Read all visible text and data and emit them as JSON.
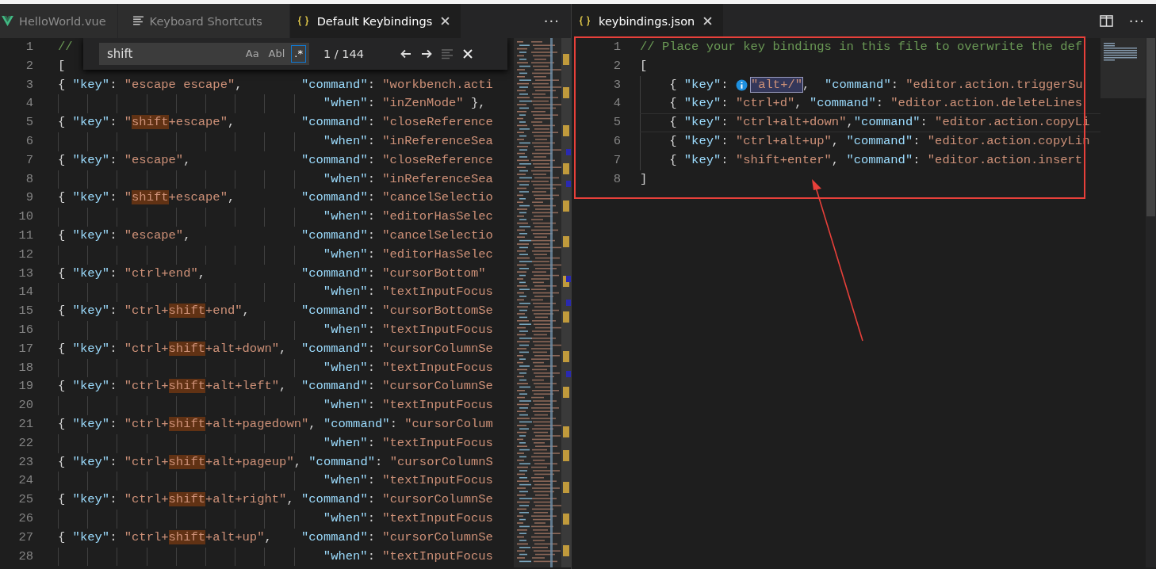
{
  "left_group": {
    "tabs": [
      {
        "label": "HelloWorld.vue",
        "kind": "vue",
        "selected": false
      },
      {
        "label": "Keyboard Shortcuts",
        "kind": "preview",
        "selected": false
      },
      {
        "label": "Default Keybindings",
        "kind": "json",
        "selected": true
      }
    ],
    "more": "···",
    "find": {
      "query": "shift",
      "toggles": [
        {
          "label": "Aa",
          "on": false
        },
        {
          "label": "Abl",
          "on": false
        },
        {
          "label": ".*",
          "on": true
        }
      ],
      "count": "1 / 144"
    },
    "lines": [
      {
        "n": "1",
        "tokens": [
          {
            "kind": "comment",
            "text": "//"
          }
        ]
      },
      {
        "n": "2",
        "tokens": [
          {
            "kind": "punct",
            "text": "["
          }
        ]
      },
      {
        "n": "3",
        "tokens": [
          {
            "kind": "punct",
            "text": "{ "
          },
          {
            "kind": "key",
            "text": "\"key\""
          },
          {
            "kind": "punct",
            "text": ": "
          },
          {
            "kind": "string",
            "text": "\"escape escape\""
          },
          {
            "kind": "punct",
            "text": ",        "
          },
          {
            "kind": "key",
            "text": "\"command\""
          },
          {
            "kind": "punct",
            "text": ": "
          },
          {
            "kind": "string",
            "text": "\"workbench.acti"
          }
        ]
      },
      {
        "n": "4",
        "kind": "continuation",
        "tokens": [
          {
            "kind": "key",
            "text": "\"when\""
          },
          {
            "kind": "punct",
            "text": ": "
          },
          {
            "kind": "string",
            "text": "\"inZenMode\""
          },
          {
            "kind": "punct",
            "text": " },"
          }
        ]
      },
      {
        "n": "5",
        "tokens": [
          {
            "kind": "punct",
            "text": "{ "
          },
          {
            "kind": "key",
            "text": "\"key\""
          },
          {
            "kind": "punct",
            "text": ": "
          },
          {
            "kind": "string",
            "text": "\""
          },
          {
            "kind": "match",
            "text": "shift"
          },
          {
            "kind": "string",
            "text": "+escape\""
          },
          {
            "kind": "punct",
            "text": ",         "
          },
          {
            "kind": "key",
            "text": "\"command\""
          },
          {
            "kind": "punct",
            "text": ": "
          },
          {
            "kind": "string",
            "text": "\"closeReference"
          }
        ]
      },
      {
        "n": "6",
        "kind": "continuation",
        "tokens": [
          {
            "kind": "key",
            "text": "\"when\""
          },
          {
            "kind": "punct",
            "text": ": "
          },
          {
            "kind": "string",
            "text": "\"inReferenceSea"
          }
        ]
      },
      {
        "n": "7",
        "tokens": [
          {
            "kind": "punct",
            "text": "{ "
          },
          {
            "kind": "key",
            "text": "\"key\""
          },
          {
            "kind": "punct",
            "text": ": "
          },
          {
            "kind": "string",
            "text": "\"escape\""
          },
          {
            "kind": "punct",
            "text": ",               "
          },
          {
            "kind": "key",
            "text": "\"command\""
          },
          {
            "kind": "punct",
            "text": ": "
          },
          {
            "kind": "string",
            "text": "\"closeReference"
          }
        ]
      },
      {
        "n": "8",
        "kind": "continuation",
        "tokens": [
          {
            "kind": "key",
            "text": "\"when\""
          },
          {
            "kind": "punct",
            "text": ": "
          },
          {
            "kind": "string",
            "text": "\"inReferenceSea"
          }
        ]
      },
      {
        "n": "9",
        "tokens": [
          {
            "kind": "punct",
            "text": "{ "
          },
          {
            "kind": "key",
            "text": "\"key\""
          },
          {
            "kind": "punct",
            "text": ": "
          },
          {
            "kind": "string",
            "text": "\""
          },
          {
            "kind": "match",
            "text": "shift"
          },
          {
            "kind": "string",
            "text": "+escape\""
          },
          {
            "kind": "punct",
            "text": ",         "
          },
          {
            "kind": "key",
            "text": "\"command\""
          },
          {
            "kind": "punct",
            "text": ": "
          },
          {
            "kind": "string",
            "text": "\"cancelSelectio"
          }
        ]
      },
      {
        "n": "10",
        "kind": "continuation",
        "tokens": [
          {
            "kind": "key",
            "text": "\"when\""
          },
          {
            "kind": "punct",
            "text": ": "
          },
          {
            "kind": "string",
            "text": "\"editorHasSelec"
          }
        ]
      },
      {
        "n": "11",
        "tokens": [
          {
            "kind": "punct",
            "text": "{ "
          },
          {
            "kind": "key",
            "text": "\"key\""
          },
          {
            "kind": "punct",
            "text": ": "
          },
          {
            "kind": "string",
            "text": "\"escape\""
          },
          {
            "kind": "punct",
            "text": ",               "
          },
          {
            "kind": "key",
            "text": "\"command\""
          },
          {
            "kind": "punct",
            "text": ": "
          },
          {
            "kind": "string",
            "text": "\"cancelSelectio"
          }
        ]
      },
      {
        "n": "12",
        "kind": "continuation",
        "tokens": [
          {
            "kind": "key",
            "text": "\"when\""
          },
          {
            "kind": "punct",
            "text": ": "
          },
          {
            "kind": "string",
            "text": "\"editorHasSelec"
          }
        ]
      },
      {
        "n": "13",
        "tokens": [
          {
            "kind": "punct",
            "text": "{ "
          },
          {
            "kind": "key",
            "text": "\"key\""
          },
          {
            "kind": "punct",
            "text": ": "
          },
          {
            "kind": "string",
            "text": "\"ctrl+end\""
          },
          {
            "kind": "punct",
            "text": ",             "
          },
          {
            "kind": "key",
            "text": "\"command\""
          },
          {
            "kind": "punct",
            "text": ": "
          },
          {
            "kind": "string",
            "text": "\"cursorBottom\""
          }
        ]
      },
      {
        "n": "14",
        "kind": "continuation",
        "tokens": [
          {
            "kind": "key",
            "text": "\"when\""
          },
          {
            "kind": "punct",
            "text": ": "
          },
          {
            "kind": "string",
            "text": "\"textInputFocus"
          }
        ]
      },
      {
        "n": "15",
        "tokens": [
          {
            "kind": "punct",
            "text": "{ "
          },
          {
            "kind": "key",
            "text": "\"key\""
          },
          {
            "kind": "punct",
            "text": ": "
          },
          {
            "kind": "string",
            "text": "\"ctrl+"
          },
          {
            "kind": "match",
            "text": "shift"
          },
          {
            "kind": "string",
            "text": "+end\""
          },
          {
            "kind": "punct",
            "text": ",       "
          },
          {
            "kind": "key",
            "text": "\"command\""
          },
          {
            "kind": "punct",
            "text": ": "
          },
          {
            "kind": "string",
            "text": "\"cursorBottomSe"
          }
        ]
      },
      {
        "n": "16",
        "kind": "continuation",
        "tokens": [
          {
            "kind": "key",
            "text": "\"when\""
          },
          {
            "kind": "punct",
            "text": ": "
          },
          {
            "kind": "string",
            "text": "\"textInputFocus"
          }
        ]
      },
      {
        "n": "17",
        "tokens": [
          {
            "kind": "punct",
            "text": "{ "
          },
          {
            "kind": "key",
            "text": "\"key\""
          },
          {
            "kind": "punct",
            "text": ": "
          },
          {
            "kind": "string",
            "text": "\"ctrl+"
          },
          {
            "kind": "match",
            "text": "shift"
          },
          {
            "kind": "string",
            "text": "+alt+down\""
          },
          {
            "kind": "punct",
            "text": ",  "
          },
          {
            "kind": "key",
            "text": "\"command\""
          },
          {
            "kind": "punct",
            "text": ": "
          },
          {
            "kind": "string",
            "text": "\"cursorColumnSe"
          }
        ]
      },
      {
        "n": "18",
        "kind": "continuation",
        "tokens": [
          {
            "kind": "key",
            "text": "\"when\""
          },
          {
            "kind": "punct",
            "text": ": "
          },
          {
            "kind": "string",
            "text": "\"textInputFocus"
          }
        ]
      },
      {
        "n": "19",
        "tokens": [
          {
            "kind": "punct",
            "text": "{ "
          },
          {
            "kind": "key",
            "text": "\"key\""
          },
          {
            "kind": "punct",
            "text": ": "
          },
          {
            "kind": "string",
            "text": "\"ctrl+"
          },
          {
            "kind": "match",
            "text": "shift"
          },
          {
            "kind": "string",
            "text": "+alt+left\""
          },
          {
            "kind": "punct",
            "text": ",  "
          },
          {
            "kind": "key",
            "text": "\"command\""
          },
          {
            "kind": "punct",
            "text": ": "
          },
          {
            "kind": "string",
            "text": "\"cursorColumnSe"
          }
        ]
      },
      {
        "n": "20",
        "kind": "continuation",
        "tokens": [
          {
            "kind": "key",
            "text": "\"when\""
          },
          {
            "kind": "punct",
            "text": ": "
          },
          {
            "kind": "string",
            "text": "\"textInputFocus"
          }
        ]
      },
      {
        "n": "21",
        "tokens": [
          {
            "kind": "punct",
            "text": "{ "
          },
          {
            "kind": "key",
            "text": "\"key\""
          },
          {
            "kind": "punct",
            "text": ": "
          },
          {
            "kind": "string",
            "text": "\"ctrl+"
          },
          {
            "kind": "match",
            "text": "shift"
          },
          {
            "kind": "string",
            "text": "+alt+pagedown\""
          },
          {
            "kind": "punct",
            "text": ", "
          },
          {
            "kind": "key",
            "text": "\"command\""
          },
          {
            "kind": "punct",
            "text": ": "
          },
          {
            "kind": "string",
            "text": "\"cursorColum"
          }
        ]
      },
      {
        "n": "22",
        "kind": "continuation",
        "tokens": [
          {
            "kind": "key",
            "text": "\"when\""
          },
          {
            "kind": "punct",
            "text": ": "
          },
          {
            "kind": "string",
            "text": "\"textInputFocus"
          }
        ]
      },
      {
        "n": "23",
        "tokens": [
          {
            "kind": "punct",
            "text": "{ "
          },
          {
            "kind": "key",
            "text": "\"key\""
          },
          {
            "kind": "punct",
            "text": ": "
          },
          {
            "kind": "string",
            "text": "\"ctrl+"
          },
          {
            "kind": "match",
            "text": "shift"
          },
          {
            "kind": "string",
            "text": "+alt+pageup\""
          },
          {
            "kind": "punct",
            "text": ", "
          },
          {
            "kind": "key",
            "text": "\"command\""
          },
          {
            "kind": "punct",
            "text": ": "
          },
          {
            "kind": "string",
            "text": "\"cursorColumnS"
          }
        ]
      },
      {
        "n": "24",
        "kind": "continuation",
        "tokens": [
          {
            "kind": "key",
            "text": "\"when\""
          },
          {
            "kind": "punct",
            "text": ": "
          },
          {
            "kind": "string",
            "text": "\"textInputFocus"
          }
        ]
      },
      {
        "n": "25",
        "tokens": [
          {
            "kind": "punct",
            "text": "{ "
          },
          {
            "kind": "key",
            "text": "\"key\""
          },
          {
            "kind": "punct",
            "text": ": "
          },
          {
            "kind": "string",
            "text": "\"ctrl+"
          },
          {
            "kind": "match",
            "text": "shift"
          },
          {
            "kind": "string",
            "text": "+alt+right\""
          },
          {
            "kind": "punct",
            "text": ", "
          },
          {
            "kind": "key",
            "text": "\"command\""
          },
          {
            "kind": "punct",
            "text": ": "
          },
          {
            "kind": "string",
            "text": "\"cursorColumnSe"
          }
        ]
      },
      {
        "n": "26",
        "kind": "continuation",
        "tokens": [
          {
            "kind": "key",
            "text": "\"when\""
          },
          {
            "kind": "punct",
            "text": ": "
          },
          {
            "kind": "string",
            "text": "\"textInputFocus"
          }
        ]
      },
      {
        "n": "27",
        "tokens": [
          {
            "kind": "punct",
            "text": "{ "
          },
          {
            "kind": "key",
            "text": "\"key\""
          },
          {
            "kind": "punct",
            "text": ": "
          },
          {
            "kind": "string",
            "text": "\"ctrl+"
          },
          {
            "kind": "match",
            "text": "shift"
          },
          {
            "kind": "string",
            "text": "+alt+up\""
          },
          {
            "kind": "punct",
            "text": ",    "
          },
          {
            "kind": "key",
            "text": "\"command\""
          },
          {
            "kind": "punct",
            "text": ": "
          },
          {
            "kind": "string",
            "text": "\"cursorColumnSe"
          }
        ]
      },
      {
        "n": "28",
        "kind": "continuation",
        "tokens": [
          {
            "kind": "key",
            "text": "\"when\""
          },
          {
            "kind": "punct",
            "text": ": "
          },
          {
            "kind": "string",
            "text": "\"textInputFocus"
          }
        ]
      }
    ]
  },
  "right_group": {
    "tabs": [
      {
        "label": "keybindings.json",
        "kind": "json",
        "selected": true
      }
    ],
    "more": "···",
    "lines": [
      {
        "n": "1",
        "tokens": [
          {
            "kind": "comment",
            "text": "// Place your key bindings in this file to overwrite the def"
          }
        ]
      },
      {
        "n": "2",
        "tokens": [
          {
            "kind": "punct",
            "text": "["
          }
        ]
      },
      {
        "n": "3",
        "kind": "nested",
        "hint": true,
        "tokens": [
          {
            "kind": "punct",
            "text": "{ "
          },
          {
            "kind": "key",
            "text": "\"key\""
          },
          {
            "kind": "punct",
            "text": ": "
          },
          {
            "kind": "selection",
            "text": "\"alt+/\""
          },
          {
            "kind": "punct",
            "text": ",  "
          },
          {
            "kind": "key",
            "text": "\"command\""
          },
          {
            "kind": "punct",
            "text": ": "
          },
          {
            "kind": "string",
            "text": "\"editor.action.triggerSu"
          }
        ]
      },
      {
        "n": "4",
        "kind": "nested",
        "tokens": [
          {
            "kind": "punct",
            "text": "{ "
          },
          {
            "kind": "key",
            "text": "\"key\""
          },
          {
            "kind": "punct",
            "text": ": "
          },
          {
            "kind": "string",
            "text": "\"ctrl+d\""
          },
          {
            "kind": "punct",
            "text": ", "
          },
          {
            "kind": "key",
            "text": "\"command\""
          },
          {
            "kind": "punct",
            "text": ": "
          },
          {
            "kind": "string",
            "text": "\"editor.action.deleteLines"
          }
        ]
      },
      {
        "n": "5",
        "kind": "nested",
        "current": true,
        "tokens": [
          {
            "kind": "punct",
            "text": "{ "
          },
          {
            "kind": "key",
            "text": "\"key\""
          },
          {
            "kind": "punct",
            "text": ": "
          },
          {
            "kind": "string",
            "text": "\"ctrl+alt+down\""
          },
          {
            "kind": "punct",
            "text": ","
          },
          {
            "kind": "key",
            "text": "\"command\""
          },
          {
            "kind": "punct",
            "text": ": "
          },
          {
            "kind": "string",
            "text": "\"editor.action.copyLi"
          }
        ]
      },
      {
        "n": "6",
        "kind": "nested",
        "tokens": [
          {
            "kind": "punct",
            "text": "{ "
          },
          {
            "kind": "key",
            "text": "\"key\""
          },
          {
            "kind": "punct",
            "text": ": "
          },
          {
            "kind": "string",
            "text": "\"ctrl+alt+up\""
          },
          {
            "kind": "punct",
            "text": ", "
          },
          {
            "kind": "key",
            "text": "\"command\""
          },
          {
            "kind": "punct",
            "text": ": "
          },
          {
            "kind": "string",
            "text": "\"editor.action.copyLin"
          }
        ]
      },
      {
        "n": "7",
        "kind": "nested",
        "tokens": [
          {
            "kind": "punct",
            "text": "{ "
          },
          {
            "kind": "key",
            "text": "\"key\""
          },
          {
            "kind": "punct",
            "text": ": "
          },
          {
            "kind": "string",
            "text": "\"shift+enter\""
          },
          {
            "kind": "punct",
            "text": ", "
          },
          {
            "kind": "key",
            "text": "\"command\""
          },
          {
            "kind": "punct",
            "text": ": "
          },
          {
            "kind": "string",
            "text": "\"editor.action.insert"
          }
        ]
      },
      {
        "n": "8",
        "tokens": [
          {
            "kind": "punct",
            "text": "]"
          }
        ]
      }
    ]
  }
}
